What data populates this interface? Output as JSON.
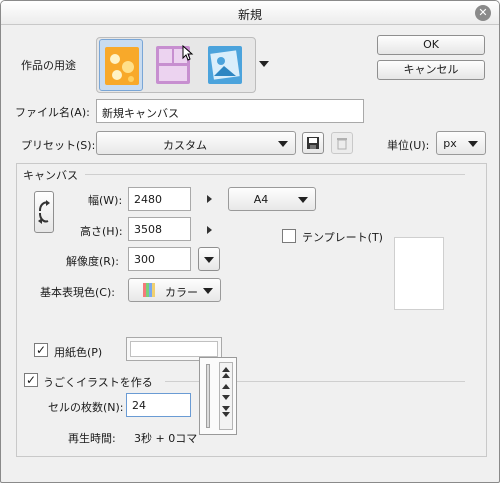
{
  "window": {
    "title": "新規",
    "close_glyph": "✕"
  },
  "usage": {
    "label": "作品の用途",
    "tiles": [
      {
        "icon": "illustration-icon",
        "selected": true,
        "color": "#f8a92a"
      },
      {
        "icon": "comic-icon",
        "selected": false,
        "color": "#c78fd0"
      },
      {
        "icon": "all-uses-icon",
        "selected": false,
        "color": "#4ba3dc"
      }
    ]
  },
  "buttons": {
    "ok": "OK",
    "cancel": "キャンセル"
  },
  "filename": {
    "label": "ファイル名(A):",
    "value": "新規キャンバス"
  },
  "preset": {
    "label": "プリセット(S):",
    "value": "カスタム"
  },
  "unit": {
    "label": "単位(U):",
    "value": "px"
  },
  "canvas": {
    "section": "キャンバス",
    "width_label": "幅(W):",
    "width": "2480",
    "height_label": "高さ(H):",
    "height": "3508",
    "resolution_label": "解像度(R):",
    "resolution": "300",
    "paper_size": "A4",
    "template_label": "テンプレート(T)",
    "color_label": "基本表現色(C):",
    "color_value": "カラー"
  },
  "paper": {
    "label": "用紙色(P)",
    "checked": true,
    "color": "#ffffff"
  },
  "animation": {
    "label": "うごくイラストを作る",
    "checked": true,
    "cels_label": "セルの枚数(N):",
    "cels": "24",
    "playback_label": "再生時間:",
    "playback": "3秒 +  0コマ"
  }
}
